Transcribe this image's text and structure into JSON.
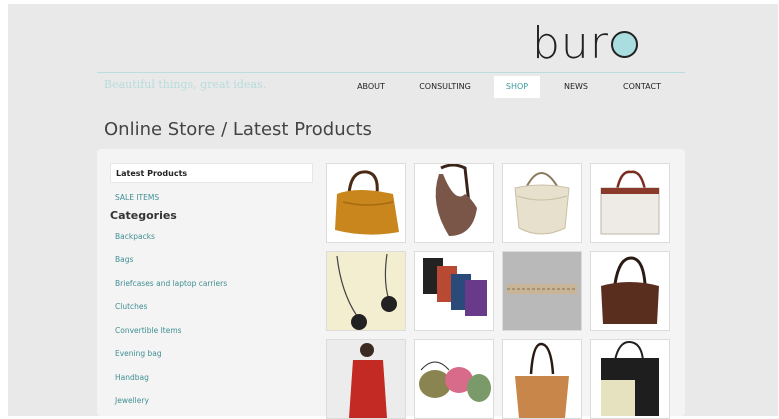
{
  "site": {
    "logo": "bur",
    "tagline": "Beautiful things, great ideas."
  },
  "nav": [
    {
      "label": "ABOUT"
    },
    {
      "label": "CONSULTING"
    },
    {
      "label": "SHOP"
    },
    {
      "label": "NEWS"
    },
    {
      "label": "CONTACT"
    }
  ],
  "page_title": "Online Store / Latest Products",
  "sidebar": {
    "current": "Latest Products",
    "sale": "SALE ITEMS",
    "categories_heading": "Categories",
    "categories": [
      "Backpacks",
      "Bags",
      "Briefcases and laptop carriers",
      "Clutches",
      "Convertible Items",
      "Evening bag",
      "Handbag",
      "Jewellery"
    ]
  },
  "products": [
    {
      "icon": "tan-leather-bag"
    },
    {
      "icon": "brown-hobo-bag"
    },
    {
      "icon": "white-shoulder-bag"
    },
    {
      "icon": "laptop-tote"
    },
    {
      "icon": "flower-necklace"
    },
    {
      "icon": "colored-belts"
    },
    {
      "icon": "woven-belt"
    },
    {
      "icon": "brown-handbag"
    },
    {
      "icon": "red-scarf"
    },
    {
      "icon": "pouch-bags"
    },
    {
      "icon": "tan-tote"
    },
    {
      "icon": "colorblock-tote"
    }
  ],
  "colors": {
    "accent": "#3a9aa0",
    "logo_dot": "#a9dde0",
    "background": "#e9e9e9"
  }
}
